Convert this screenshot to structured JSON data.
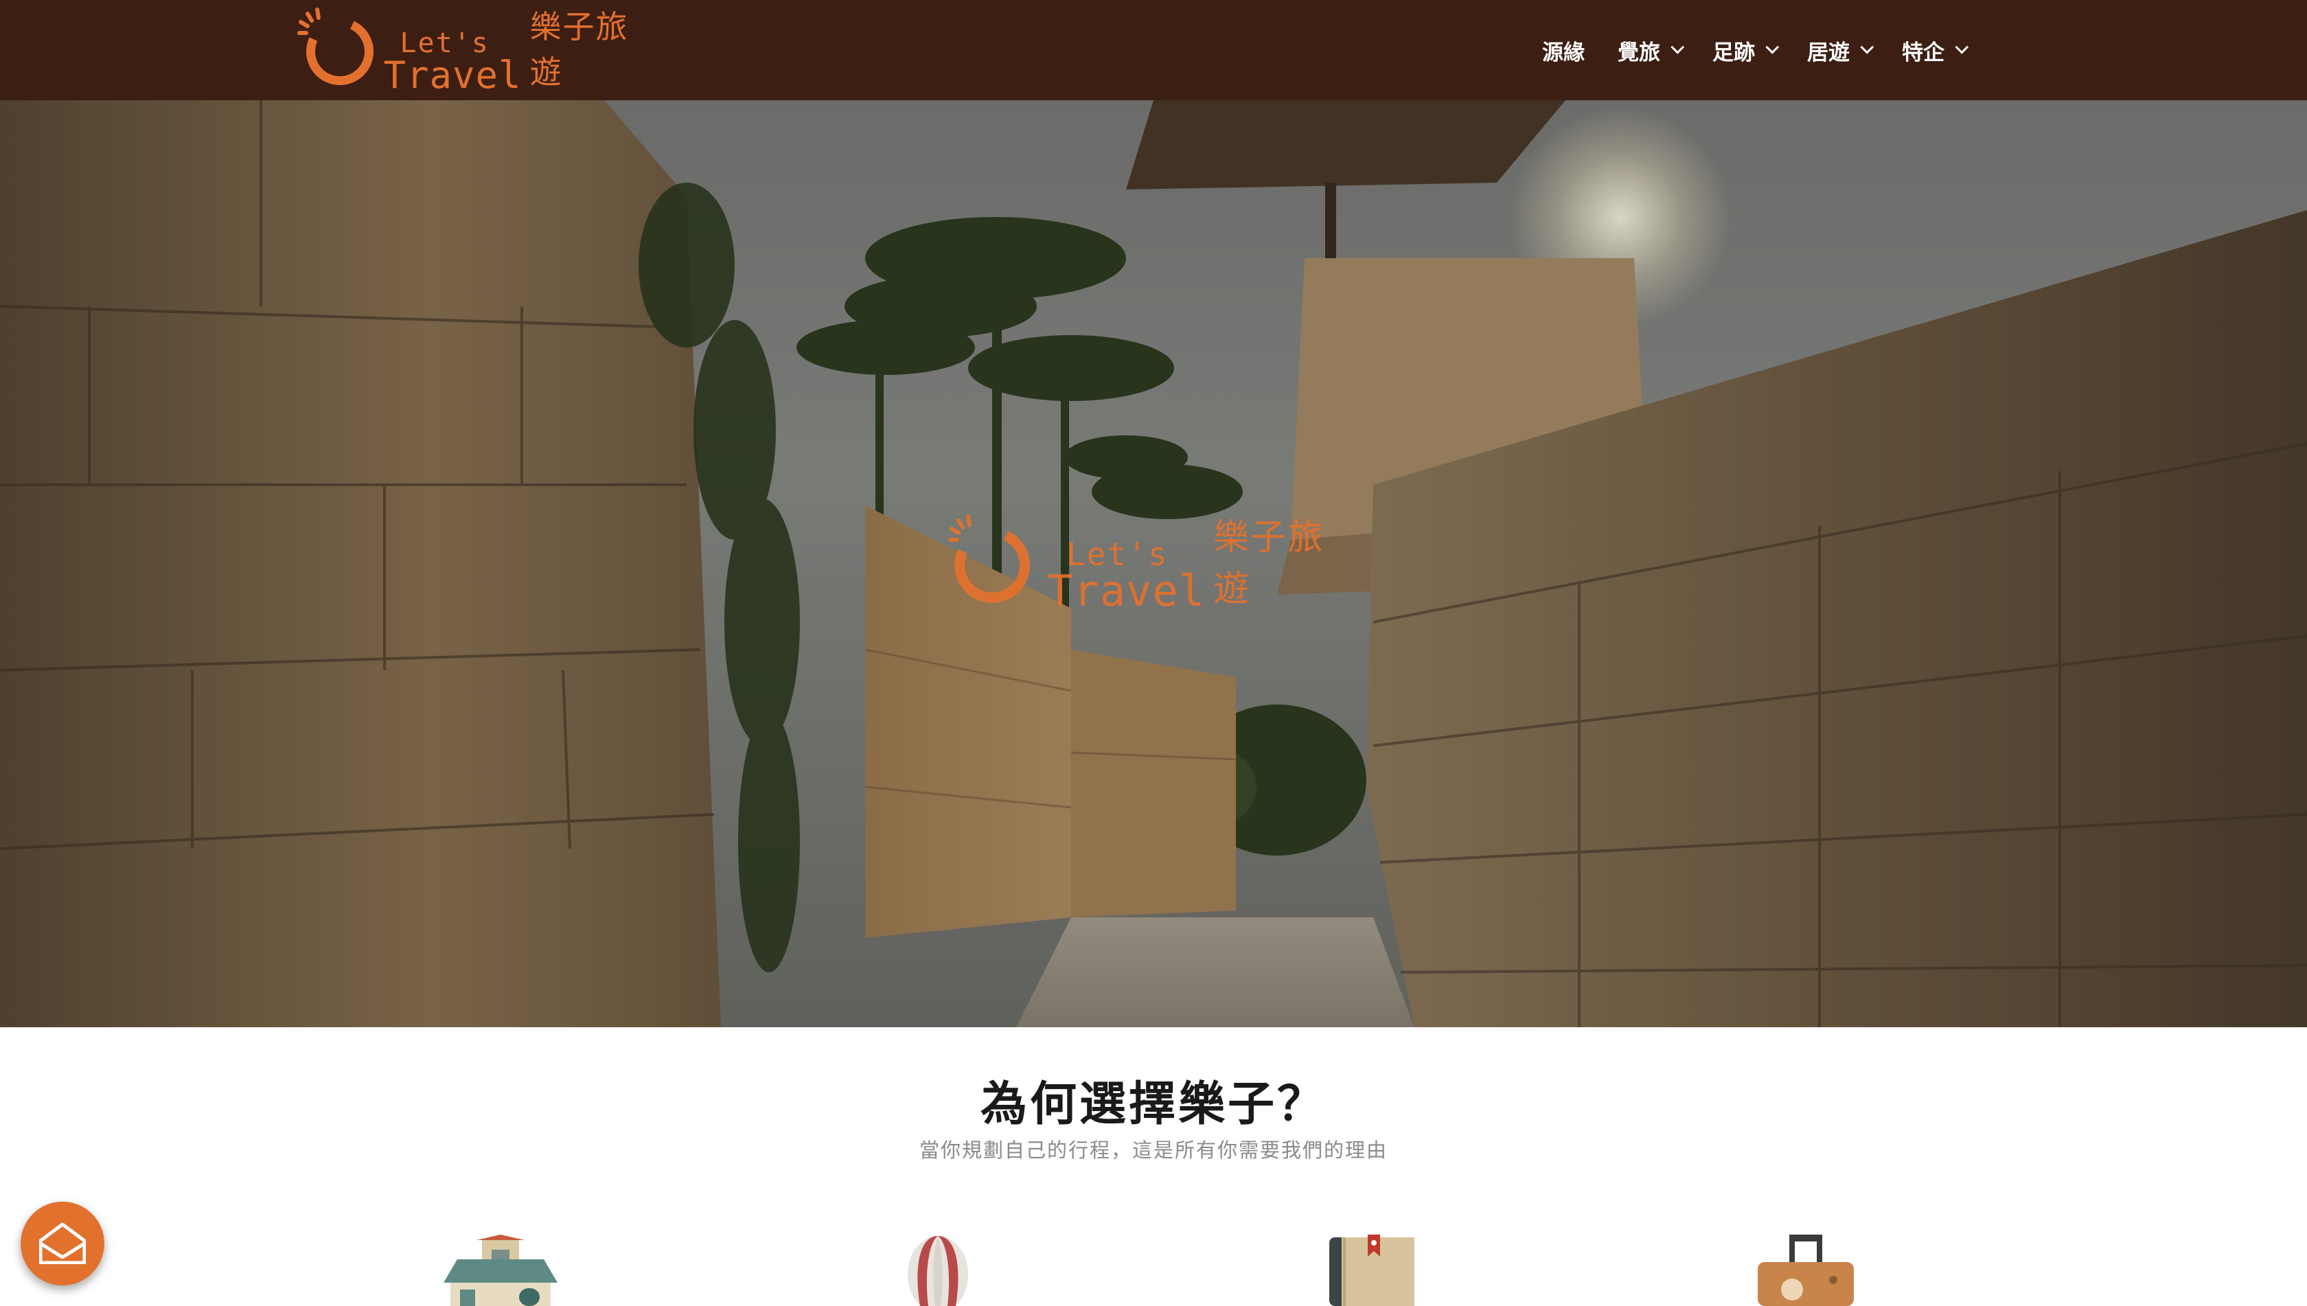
{
  "brand": {
    "latin_line1": "Let's",
    "latin_line2": "Travel",
    "cjk": "樂子旅遊",
    "accent_color": "#e2712e",
    "navbar_color": "#3c1e13"
  },
  "nav": {
    "items": [
      {
        "label": "源緣",
        "has_dropdown": false
      },
      {
        "label": "覺旅",
        "has_dropdown": true
      },
      {
        "label": "足跡",
        "has_dropdown": true
      },
      {
        "label": "居遊",
        "has_dropdown": true
      },
      {
        "label": "特企",
        "has_dropdown": true
      }
    ]
  },
  "hero": {
    "image": "stone-walled-alley-with-palm-trees"
  },
  "why": {
    "title": "為何選擇樂子？",
    "subtitle": "當你規劃自己的行程，這是所有你需要我們的理由",
    "features": [
      {
        "icon": "house-icon"
      },
      {
        "icon": "hot-air-balloon-icon"
      },
      {
        "icon": "guidebook-icon"
      },
      {
        "icon": "suitcase-icon"
      }
    ]
  },
  "floating": {
    "icon": "mail-icon"
  }
}
